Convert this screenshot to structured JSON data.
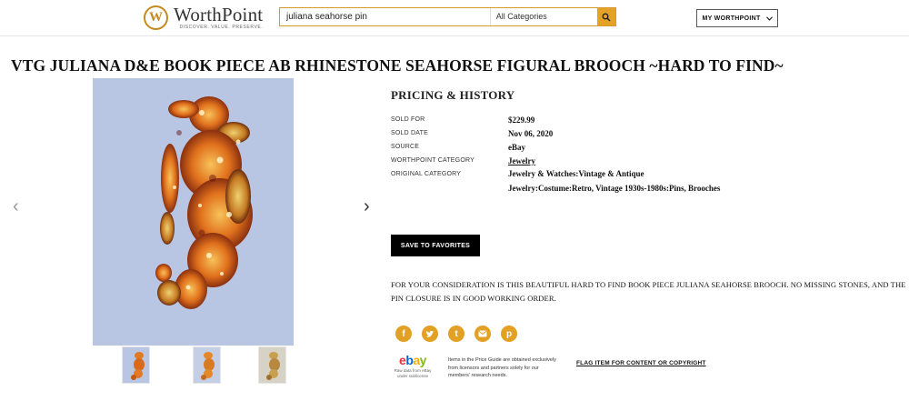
{
  "header": {
    "logo_name": "WorthPoint",
    "logo_tagline": "DISCOVER. VALUE. PRESERVE.",
    "search_value": "juliana seahorse pin",
    "category_select": "All Categories",
    "my_worthpoint_label": "MY WORTHPOINT",
    "accent_color": "#e2a328"
  },
  "item": {
    "title": "VTG JULIANA D&E BOOK PIECE AB RHINESTONE SEAHORSE FIGURAL BROOCH ~HARD TO FIND~"
  },
  "pricing": {
    "heading": "PRICING & HISTORY",
    "rows": [
      {
        "label": "SOLD FOR",
        "value": "$229.99"
      },
      {
        "label": "SOLD DATE",
        "value": "Nov 06, 2020"
      },
      {
        "label": "SOURCE",
        "value": "eBay"
      },
      {
        "label": "WORTHPOINT CATEGORY",
        "value": "Jewelry"
      },
      {
        "label": "ORIGINAL CATEGORY",
        "value": "Jewelry & Watches:Vintage & Antique Jewelry:Costume:Retro, Vintage 1930s-1980s:Pins, Brooches"
      }
    ],
    "save_button": "SAVE TO FAVORITES"
  },
  "description": "FOR YOUR CONSIDERATION IS THIS BEAUTIFUL HARD TO FIND BOOK PIECE JULIANA SEAHORSE BROOCH. NO MISSING STONES, AND THE PIN CLOSURE IS IN GOOD WORKING ORDER.",
  "share_icons": [
    "facebook-icon",
    "twitter-icon",
    "tumblr-icon",
    "email-icon",
    "pinterest-icon"
  ],
  "footer": {
    "ebay_logo": "ebay",
    "ebay_subtext": "Raw data from eBay under sublicense",
    "price_guide_note": "Items in the Price Guide are obtained exclusively from licensors and partners solely for our members' research needs.",
    "flag_link": "FLAG ITEM FOR CONTENT OR COPYRIGHT"
  }
}
